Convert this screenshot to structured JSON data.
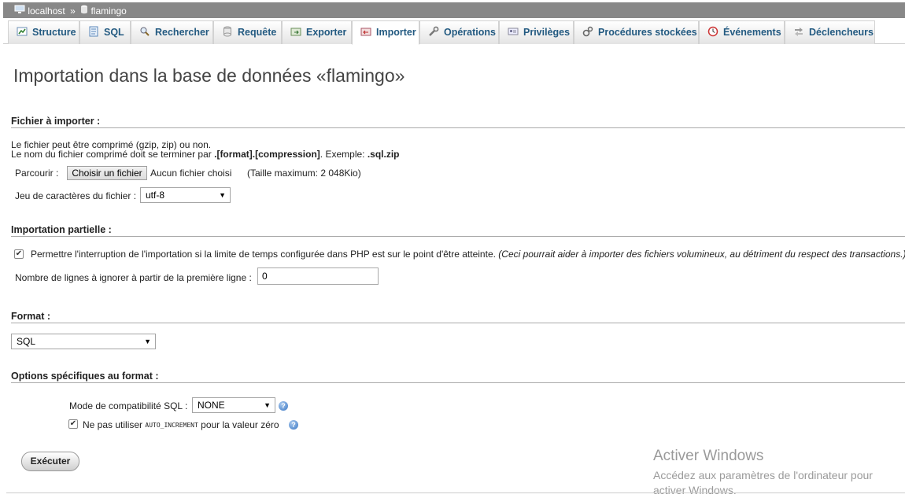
{
  "breadcrumb": {
    "server": "localhost",
    "sep": "»",
    "database": "flamingo"
  },
  "tabs": [
    {
      "label": "Structure",
      "icon": "structure-icon"
    },
    {
      "label": "SQL",
      "icon": "sql-icon"
    },
    {
      "label": "Rechercher",
      "icon": "search-icon"
    },
    {
      "label": "Requête",
      "icon": "query-icon"
    },
    {
      "label": "Exporter",
      "icon": "export-icon"
    },
    {
      "label": "Importer",
      "icon": "import-icon",
      "active": true
    },
    {
      "label": "Opérations",
      "icon": "wrench-icon"
    },
    {
      "label": "Privilèges",
      "icon": "privileges-icon"
    },
    {
      "label": "Procédures stockées",
      "icon": "routines-icon"
    },
    {
      "label": "Événements",
      "icon": "events-icon"
    },
    {
      "label": "Déclencheurs",
      "icon": "triggers-icon"
    }
  ],
  "title": "Importation dans la base de données «flamingo»",
  "file_section": {
    "heading": "Fichier à importer :",
    "line1": "Le fichier peut être comprimé (gzip, zip) ou non.",
    "line2_prefix": "Le nom du fichier comprimé doit se terminer par ",
    "line2_bold": ".[format].[compression]",
    "line2_mid": ". Exemple: ",
    "line2_example": ".sql.zip",
    "browse_label": "Parcourir :",
    "choose_button": "Choisir un fichier",
    "no_file": "Aucun fichier choisi",
    "max_size": "(Taille maximum: 2  048Kio)",
    "charset_label": "Jeu de caractères du fichier :",
    "charset_value": "utf-8"
  },
  "partial_section": {
    "heading": "Importation partielle :",
    "allow_interrupt": "Permettre l'interruption de l'importation si la limite de temps configurée dans PHP est sur le point d'être atteinte.",
    "allow_interrupt_note": "(Ceci pourrait aider à importer des fichiers volumineux, au détriment du respect des transactions.)",
    "allow_interrupt_checked": true,
    "skip_label": "Nombre de lignes à ignorer à partir de la première ligne :",
    "skip_value": "0"
  },
  "format_section": {
    "heading": "Format :",
    "format_value": "SQL"
  },
  "options_section": {
    "heading": "Options spécifiques au format :",
    "compat_label": "Mode de compatibilité SQL :",
    "compat_value": "NONE",
    "no_auto_prefix": "Ne pas utiliser",
    "no_auto_code": "AUTO_INCREMENT",
    "no_auto_suffix": "pour la valeur zéro",
    "no_auto_checked": true
  },
  "execute_button": "Exécuter",
  "watermark": {
    "title": "Activer Windows",
    "line1": "Accédez aux paramètres de l'ordinateur pour",
    "line2": "activer Windows."
  },
  "colors": {
    "breadcrumb_bg": "#888888",
    "tab_text": "#235a81",
    "title_text": "#444444"
  }
}
